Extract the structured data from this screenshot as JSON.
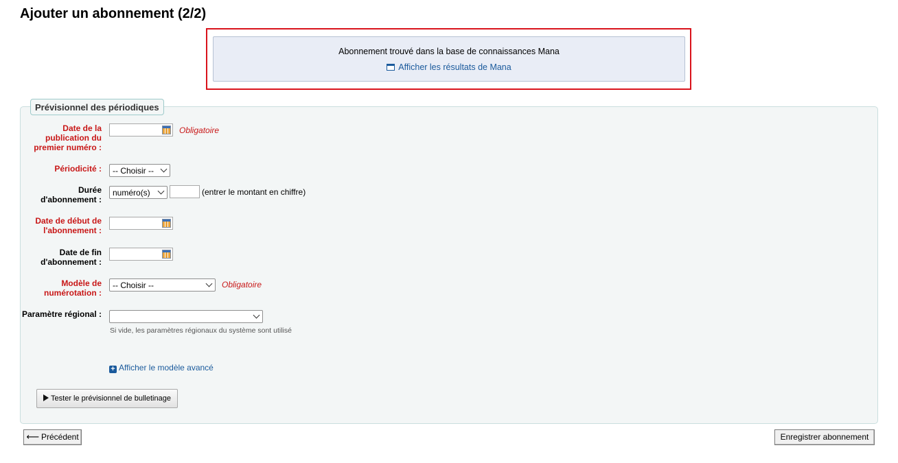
{
  "page": {
    "title": "Ajouter un abonnement (2/2)"
  },
  "mana": {
    "message": "Abonnement trouvé dans la base de connaissances Mana",
    "link_label": "Afficher les résultats de Mana"
  },
  "fieldset": {
    "legend": "Prévisionnel des périodiques",
    "first_issue": {
      "label": "Date de la publication du premier numéro :",
      "required_hint": "Obligatoire",
      "value": ""
    },
    "frequency": {
      "label": "Périodicité :",
      "selected": "-- Choisir --"
    },
    "duration": {
      "label": "Durée d'abonnement :",
      "unit_selected": "numéro(s)",
      "value": "",
      "hint": "(entrer le montant en chiffre)"
    },
    "start_date": {
      "label": "Date de début de l'abonnement :",
      "value": ""
    },
    "end_date": {
      "label": "Date de fin d'abonnement :",
      "value": ""
    },
    "numbering_pattern": {
      "label": "Modèle de numérotation :",
      "selected": "-- Choisir --",
      "required_hint": "Obligatoire"
    },
    "locale": {
      "label": "Paramètre régional :",
      "selected": "",
      "help": "Si vide, les paramètres régionaux du système sont utilisé"
    },
    "advanced_link": "Afficher le modèle avancé",
    "test_button": "Tester le prévisionnel de bulletinage"
  },
  "footer": {
    "previous_button": "Précédent",
    "save_button": "Enregistrer abonnement"
  },
  "colors": {
    "required": "#c81717",
    "link": "#1a5a9c",
    "highlight": "#d9121b"
  }
}
